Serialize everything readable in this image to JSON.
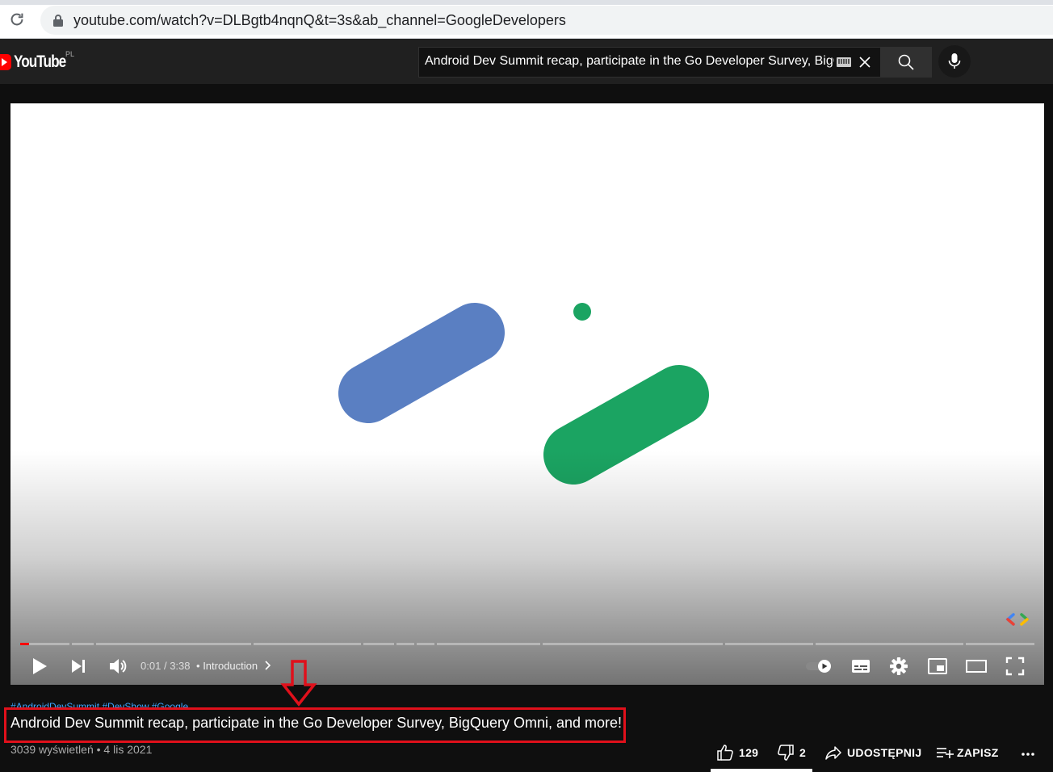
{
  "browser": {
    "url": "youtube.com/watch?v=DLBgtb4nqnQ&t=3s&ab_channel=GoogleDevelopers"
  },
  "masthead": {
    "logo_text": "YouTube",
    "country_code": "PL",
    "search_value": "Android Dev Summit recap, participate in the Go Developer Survey, BigQuery Omni, and more!"
  },
  "player": {
    "progress_fraction": 0.006,
    "time_current": "0:01",
    "time_separator": "/",
    "time_total": "3:38",
    "chapter_separator": "•",
    "chapter": "Introduction"
  },
  "video": {
    "hashtags": "#AndroidDevSummit #DevShow #Google",
    "title": "Android Dev Summit recap, participate in the Go Developer Survey, BigQuery Omni, and more!",
    "views": "3039 wyświetleń",
    "dot": "•",
    "date": "4 lis 2021"
  },
  "actions": {
    "likes": "129",
    "dislikes": "2",
    "share_label": "UDOSTĘPNIJ",
    "save_label": "ZAPISZ"
  },
  "colors": {
    "accent_red": "#ff0000",
    "annotation_red": "#e0101b",
    "blue_shape": "#5a7fc2",
    "green_shape": "#1ba462"
  }
}
